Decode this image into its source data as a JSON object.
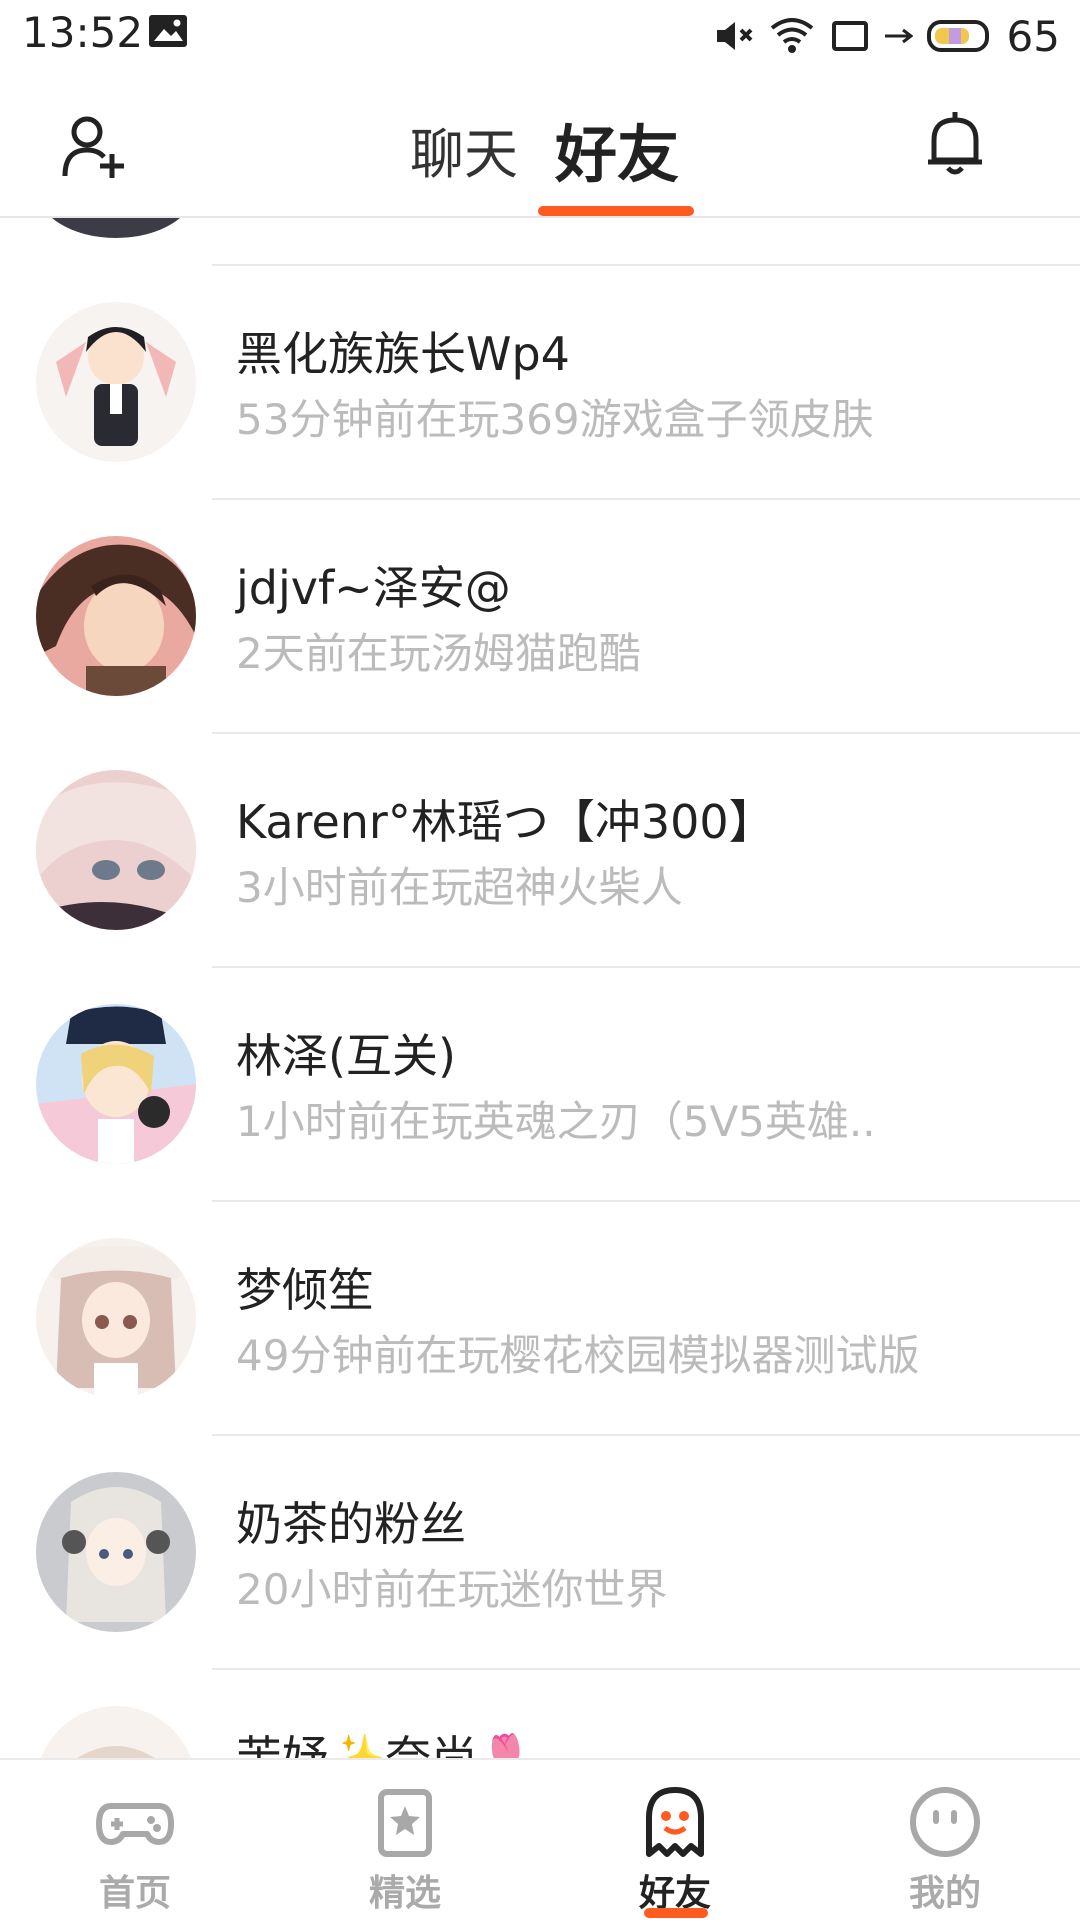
{
  "status_bar": {
    "time": "13:52",
    "battery_level": "65",
    "icons": [
      "gallery-icon",
      "mute-icon",
      "wifi-icon",
      "screen-icon",
      "usb-icon",
      "battery-icon"
    ]
  },
  "header": {
    "tabs": [
      {
        "label": "聊天",
        "active": false
      },
      {
        "label": "好友",
        "active": true
      }
    ],
    "accent_color": "#ff5a1f"
  },
  "friends": [
    {
      "name": "黑化族族长Wp4",
      "status": "53分钟前在玩369游戏盒子领皮肤"
    },
    {
      "name": "jdjvf~泽安@",
      "status": "2天前在玩汤姆猫跑酷"
    },
    {
      "name": "Karenr°林瑶つ【冲300】",
      "status": "3小时前在玩超神火柴人"
    },
    {
      "name": "林泽(互关)",
      "status": "1小时前在玩英魂之刃（5V5英雄.."
    },
    {
      "name": "梦倾笙",
      "status": "49分钟前在玩樱花校园模拟器测试版"
    },
    {
      "name": "奶茶的粉丝",
      "status": "20小时前在玩迷你世界"
    },
    {
      "name": "苦妤✨奈尚🌷",
      "status": ""
    }
  ],
  "bottom_nav": [
    {
      "label": "首页",
      "icon": "gamepad-icon",
      "active": false
    },
    {
      "label": "精选",
      "icon": "star-bookmark-icon",
      "active": false
    },
    {
      "label": "好友",
      "icon": "ghost-icon",
      "active": true
    },
    {
      "label": "我的",
      "icon": "face-icon",
      "active": false
    }
  ]
}
